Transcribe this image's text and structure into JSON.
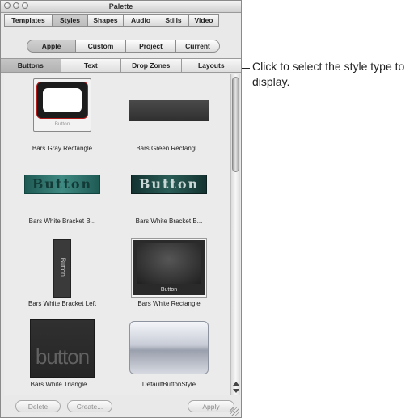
{
  "window": {
    "title": "Palette"
  },
  "tabs": [
    "Templates",
    "Styles",
    "Shapes",
    "Audio",
    "Stills",
    "Video"
  ],
  "active_tab": "Styles",
  "sources": [
    "Apple",
    "Custom",
    "Project",
    "Current"
  ],
  "active_source": "Apple",
  "style_types": [
    "Buttons",
    "Text",
    "Drop Zones",
    "Layouts"
  ],
  "active_style_type": "Buttons",
  "items": [
    {
      "label": "Bars Gray Rectangle",
      "thumb_text": "Button"
    },
    {
      "label": "Bars Green Rectangl..."
    },
    {
      "label": "Bars White Bracket B...",
      "thumb_text": "Button"
    },
    {
      "label": "Bars White Bracket B...",
      "thumb_text": "Button"
    },
    {
      "label": "Bars White Bracket Left",
      "thumb_text": "Button"
    },
    {
      "label": "Bars White Rectangle",
      "thumb_text": "Button"
    },
    {
      "label": "Bars White Triangle ...",
      "thumb_text": "button"
    },
    {
      "label": "DefaultButtonStyle"
    }
  ],
  "buttons": {
    "delete": "Delete",
    "create": "Create...",
    "apply": "Apply"
  },
  "callout": {
    "text": "Click to select the style type to display."
  },
  "colors": {
    "teal_button": "#2f6b66",
    "dark_thumb": "#3a3a3a",
    "accent_red": "#b21a1a"
  }
}
